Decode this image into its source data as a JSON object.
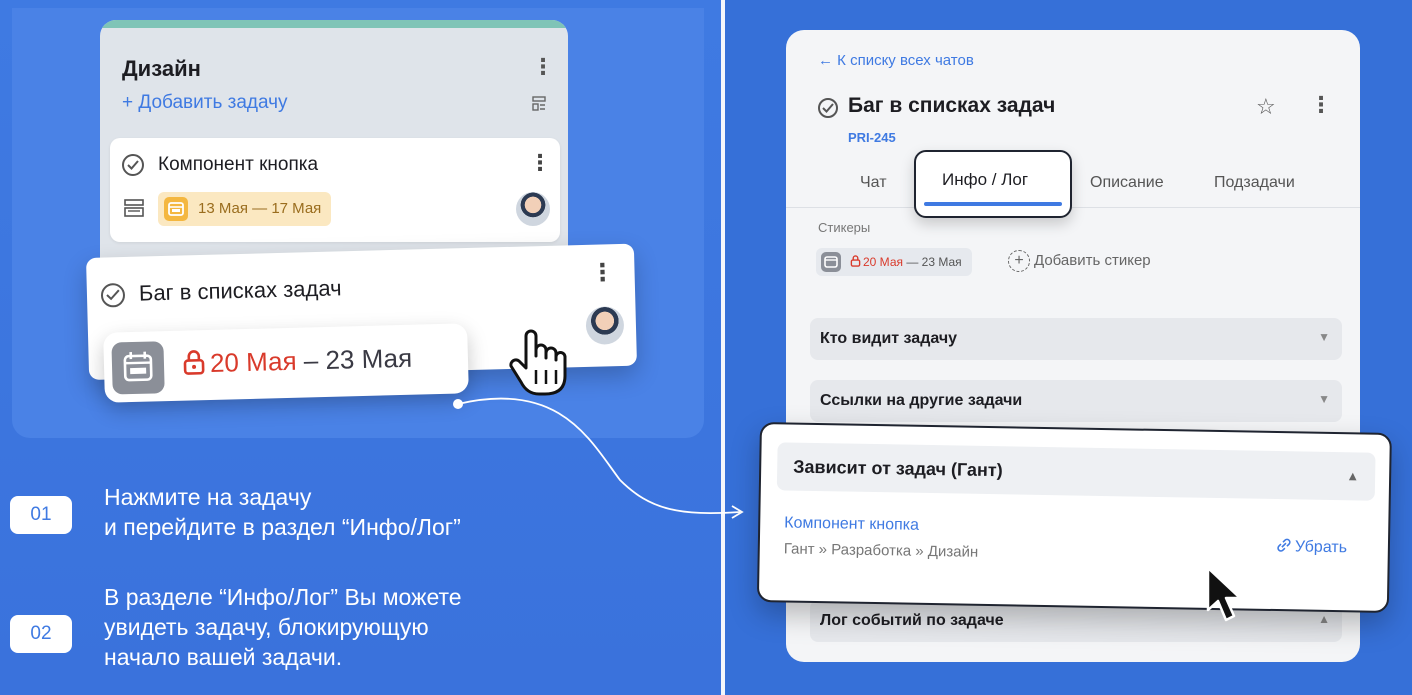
{
  "kanban": {
    "column_title": "Дизайн",
    "add_task": "+ Добавить задачу",
    "card1": {
      "title": "Компонент кнопка",
      "date": "13 Мая — 17 Мая"
    },
    "card2": {
      "title": "Баг в списках задач",
      "date_start": "20 Мая",
      "date_sep": " – ",
      "date_end": "23 Мая"
    }
  },
  "steps": [
    {
      "num": "01",
      "lines": [
        "Нажмите на задачу",
        "и перейдите в раздел “Инфо/Лог”"
      ]
    },
    {
      "num": "02",
      "lines": [
        "В разделе “Инфо/Лог” Вы можете",
        "увидеть задачу, блокирующую",
        "начало вашей задачи."
      ]
    }
  ],
  "panel": {
    "back": "← К списку всех чатов",
    "title": "Баг в списках задач",
    "code": "PRI-245",
    "tabs": [
      "Чат",
      "Инфо / Лог",
      "Описание",
      "Подзадачи"
    ],
    "stickers_label": "Стикеры",
    "sticker_start": "20 Мая",
    "sticker_end": " — 23 Мая",
    "add_sticker": "Добавить стикер",
    "sections": [
      "Кто видит задачу",
      "Ссылки на другие задачи",
      "Лог событий по задаче"
    ]
  },
  "gantt": {
    "title": "Зависит от задач (Гант)",
    "link": "Компонент кнопка",
    "path": "Гант » Разработка » Дизайн",
    "remove": "Убрать"
  },
  "colors": {
    "accent": "#3f7ae2",
    "lock_red": "#d93a2b",
    "column_strip": "#7fc4b7",
    "date_amber": "#f4b740"
  }
}
